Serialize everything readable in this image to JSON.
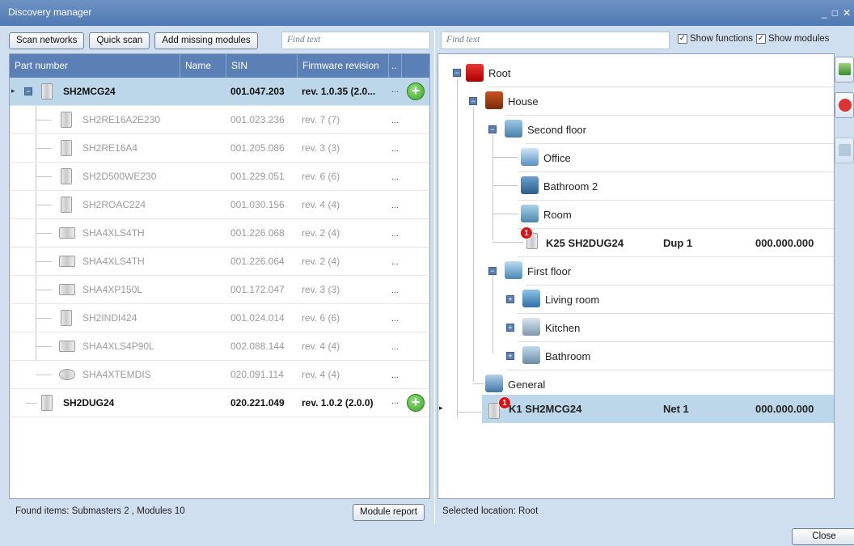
{
  "window": {
    "title": "Discovery manager",
    "controls": [
      "_",
      "□",
      "✕"
    ]
  },
  "toolbar": {
    "scan_networks": "Scan networks",
    "quick_scan": "Quick scan",
    "add_missing": "Add missing modules",
    "find_left_placeholder": "Find text",
    "find_right_placeholder": "Find text",
    "show_functions": "Show functions",
    "show_modules": "Show modules"
  },
  "grid": {
    "headers": [
      "Part number",
      "Name",
      "SIN",
      "Firmware revision",
      ".."
    ],
    "rows": [
      {
        "type": "master",
        "part": "SH2MCG24",
        "name": "",
        "sin": "001.047.203",
        "fw": "rev. 1.0.35 (2.0...",
        "more": "...",
        "selected": true
      },
      {
        "type": "sub",
        "part": "SH2RE16A2E230",
        "name": "",
        "sin": "001.023.236",
        "fw": "rev. 7 (7)",
        "more": "..."
      },
      {
        "type": "sub",
        "part": "SH2RE16A4",
        "name": "",
        "sin": "001.205.086",
        "fw": "rev. 3 (3)",
        "more": "..."
      },
      {
        "type": "sub",
        "part": "SH2D500WE230",
        "name": "",
        "sin": "001.229.051",
        "fw": "rev. 6 (6)",
        "more": "..."
      },
      {
        "type": "sub",
        "part": "SH2ROAC224",
        "name": "",
        "sin": "001.030.156",
        "fw": "rev. 4 (4)",
        "more": "..."
      },
      {
        "type": "sub",
        "part": "SHA4XLS4TH",
        "name": "",
        "sin": "001.226.068",
        "fw": "rev. 2 (4)",
        "more": "..."
      },
      {
        "type": "sub",
        "part": "SHA4XLS4TH",
        "name": "",
        "sin": "001.226.064",
        "fw": "rev. 2 (4)",
        "more": "..."
      },
      {
        "type": "sub",
        "part": "SHA4XP150L",
        "name": "",
        "sin": "001.172.047",
        "fw": "rev. 3 (3)",
        "more": "..."
      },
      {
        "type": "sub",
        "part": "SH2INDI424",
        "name": "",
        "sin": "001.024.014",
        "fw": "rev. 6 (6)",
        "more": "..."
      },
      {
        "type": "sub",
        "part": "SHA4XLS4P90L",
        "name": "",
        "sin": "002.088.144",
        "fw": "rev. 4 (4)",
        "more": "..."
      },
      {
        "type": "sub",
        "part": "SHA4XTEMDIS",
        "name": "",
        "sin": "020.091.114",
        "fw": "rev. 4 (4)",
        "more": "..."
      },
      {
        "type": "master",
        "part": "SH2DUG24",
        "name": "",
        "sin": "020.221.049",
        "fw": "rev. 1.0.2 (2.0.0)",
        "more": "..."
      }
    ]
  },
  "tree": {
    "root": "Root",
    "house": "House",
    "second_floor": "Second floor",
    "office": "Office",
    "bathroom2": "Bathroom 2",
    "room": "Room",
    "k25": {
      "label": "K25 SH2DUG24",
      "net": "Dup 1",
      "addr": "000.000.000",
      "badge": "1"
    },
    "first_floor": "First floor",
    "living_room": "Living room",
    "kitchen": "Kitchen",
    "bathroom": "Bathroom",
    "general": "General",
    "k1": {
      "label": "K1 SH2MCG24",
      "net": "Net 1",
      "addr": "000.000.000",
      "badge": "1"
    }
  },
  "status": {
    "found": "Found items: Submasters 2 , Modules 10",
    "selected_location": "Selected location: Root"
  },
  "buttons": {
    "module_report": "Module report",
    "close": "Close"
  },
  "colors": {
    "title_bar": "#5a82b8",
    "grid_header": "#5b80b6",
    "selected_row": "#bdd7ea",
    "add_green": "#3da32a",
    "badge_red": "#d11111"
  }
}
